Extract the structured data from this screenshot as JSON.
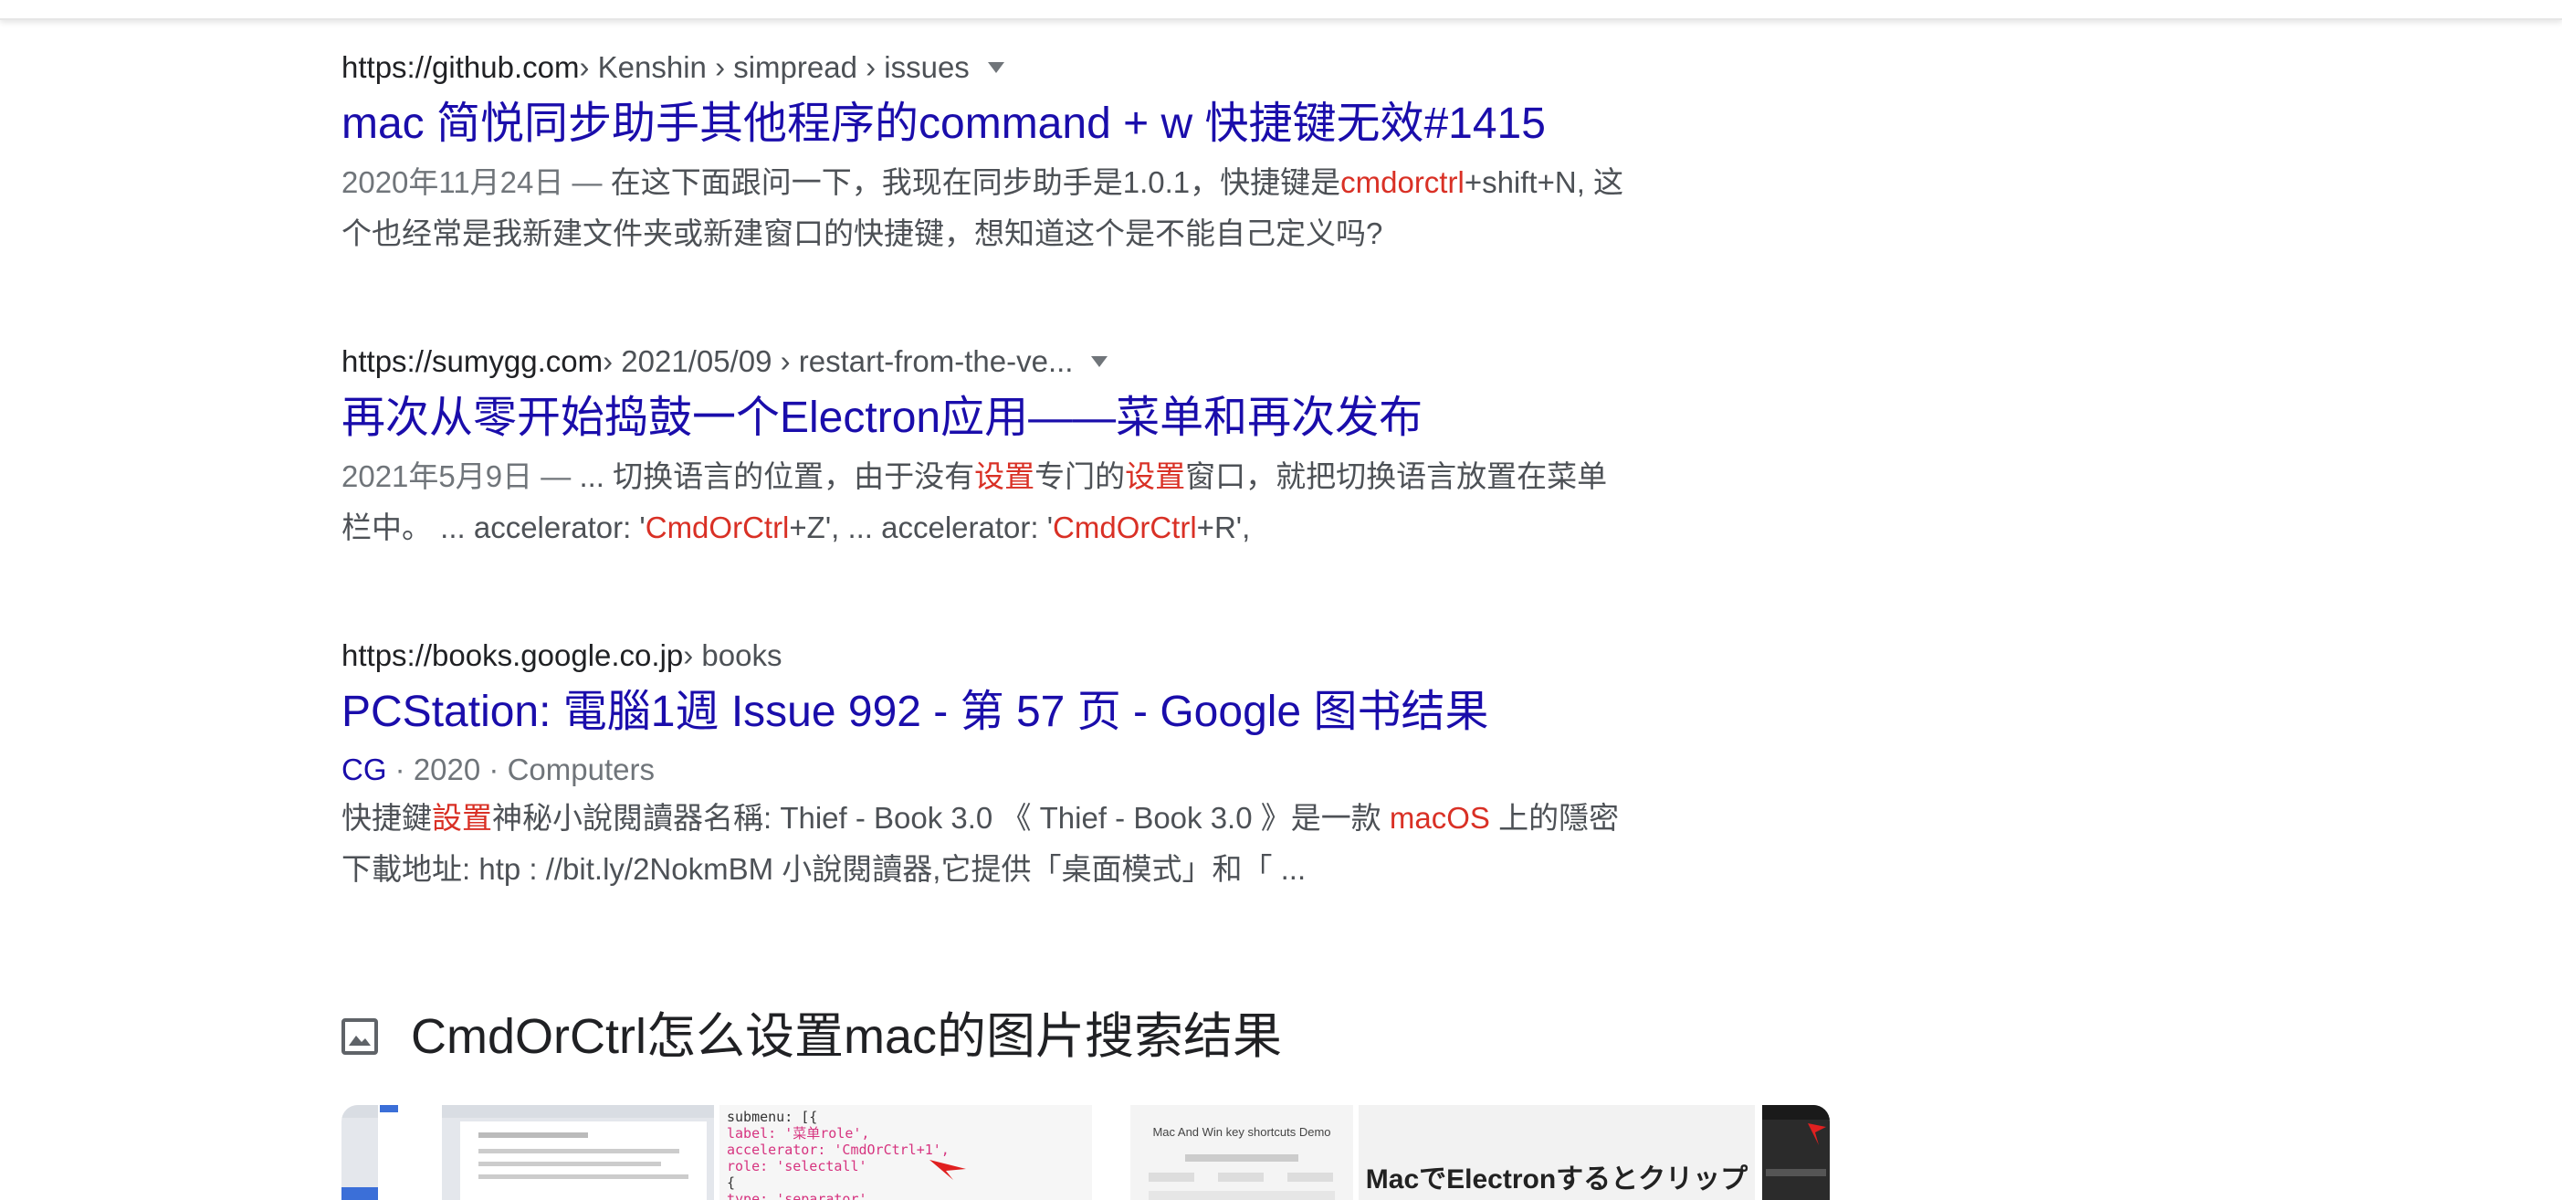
{
  "results": [
    {
      "url_host": "https://github.com",
      "url_path": " › Kenshin › simpread › issues",
      "title": "mac 简悦同步助手其他程序的command + w 快捷键无效#1415",
      "date": "2020年11月24日 — ",
      "snippet_a": "在这下面跟问一下，我现在同步助手是1.0.1，快捷键是",
      "snippet_hl1": "cmdorctrl",
      "snippet_b": "+shift+N, 这",
      "snippet_line2": "个也经常是我新建文件夹或新建窗口的快捷键，想知道这个是不能自己定义吗?"
    },
    {
      "url_host": "https://sumygg.com",
      "url_path": " › 2021/05/09 › restart-from-the-ve...",
      "title": "再次从零开始捣鼓一个Electron应用——菜单和再次发布",
      "date": "2021年5月9日 — ",
      "snippet_a": "... 切换语言的位置，由于没有",
      "snippet_hl1": "设置",
      "snippet_b": "专门的",
      "snippet_hl2": "设置",
      "snippet_c": "窗口，就把切换语言放置在菜单",
      "snippet_d": "栏中。 ... accelerator: '",
      "snippet_hl3": "CmdOrCtrl",
      "snippet_e": "+Z', ... accelerator: '",
      "snippet_hl4": "CmdOrCtrl",
      "snippet_f": "+R',"
    },
    {
      "url_host": "https://books.google.co.jp",
      "url_path": " › books",
      "title": "PCStation: 電腦1週 Issue 992 - 第 57 页 - Google 图书结果",
      "meta_author": "CG",
      "meta_rest": " · 2020 · Computers",
      "snippet_a": "快捷鍵",
      "snippet_hl1": "設置",
      "snippet_b": "神秘小說閱讀器名稱: Thief - Book 3.0 《 Thief - Book 3.0 》是一款 ",
      "snippet_hl2": "macOS",
      "snippet_c": " 上的隱密",
      "snippet_line2": "下載地址: htp : //bit.ly/2NokmBM 小說閱讀器,它提供「桌面模式」和「 ..."
    }
  ],
  "images_section": {
    "icon": "image-icon",
    "heading": "CmdOrCtrl怎么设置mac的图片搜索结果",
    "thumb2_code": [
      "submenu: [{",
      "  label: '菜单role',",
      "  accelerator: 'CmdOrCtrl+1',",
      "  role: 'selectall'",
      "{",
      "type: 'separator'"
    ],
    "thumb3_text": "Mac And Win key shortcuts Demo",
    "thumb4_text": "MacでElectronするとクリップ"
  },
  "colors": {
    "link": "#1a0dab",
    "highlight": "#d93025",
    "snippet": "#4d5156"
  }
}
